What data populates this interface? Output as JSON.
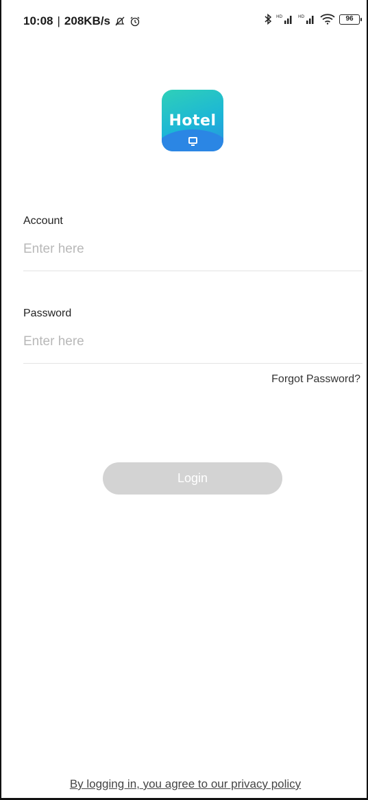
{
  "status_bar": {
    "time": "10:08",
    "separator": "|",
    "speed": "208KB/s",
    "battery": "96",
    "signal_hd_1": "HD",
    "signal_hd_2": "HD"
  },
  "logo": {
    "text": "Hotel"
  },
  "account": {
    "label": "Account",
    "placeholder": "Enter here"
  },
  "password": {
    "label": "Password",
    "placeholder": "Enter here"
  },
  "forgot_label": "Forgot Password?",
  "login_label": "Login",
  "privacy_label": "By logging in, you agree to our privacy policy",
  "colors": {
    "login_button_disabled": "#d3d3d3",
    "logo_gradient_start": "#2fd0b8",
    "logo_gradient_end": "#2a8fe0"
  }
}
